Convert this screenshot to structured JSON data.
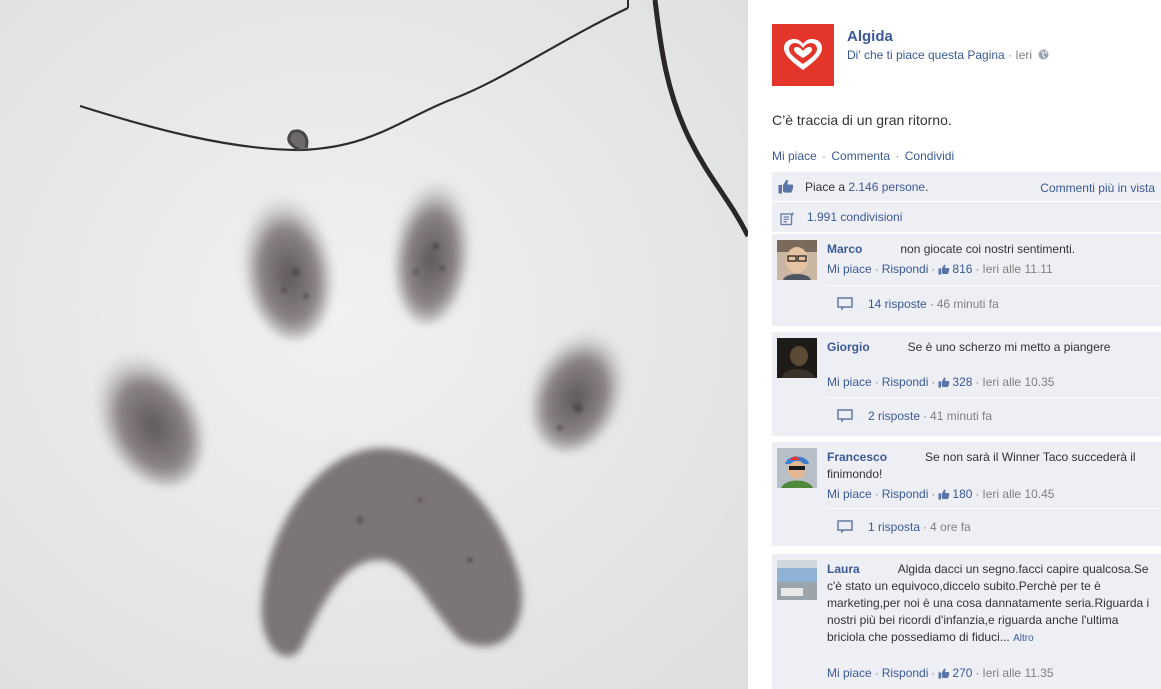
{
  "page": {
    "name": "Algida",
    "like_link": "Di' che ti piace questa Pagina",
    "separator": "·",
    "time": "Ieri"
  },
  "post": {
    "text": "C’è traccia di un gran ritorno."
  },
  "actions": {
    "like": "Mi piace",
    "comment": "Commenta",
    "share": "Condividi"
  },
  "likes": {
    "prefix": "Piace a",
    "count_link": "2.146 persone",
    "suffix": ".",
    "filter": "Commenti più in vista"
  },
  "shares": {
    "text": "1.991 condivisioni"
  },
  "icons": {
    "page_logo": "algida-heart-logo",
    "privacy": "globe-icon",
    "likes": "thumbs-up-icon",
    "shares": "share-icon",
    "replies": "speech-bubble-icon"
  },
  "colors": {
    "link": "#3b5998",
    "brand": "#e3352a",
    "ufi_bg": "#edeff4"
  },
  "comments": [
    {
      "author": "Marco",
      "text": "non giocate coi nostri sentimenti.",
      "like_label": "Mi piace",
      "reply_label": "Rispondi",
      "likes": "816",
      "time": "Ieri alle 11.11",
      "replies": "14 risposte",
      "reply_time": "46 minuti fa"
    },
    {
      "author": "Giorgio",
      "text": "Se è uno scherzo mi metto a piangere",
      "like_label": "Mi piace",
      "reply_label": "Rispondi",
      "likes": "328",
      "time": "Ieri alle 10.35",
      "replies": "2 risposte",
      "reply_time": "41 minuti fa"
    },
    {
      "author": "Francesco",
      "text": "Se non sarà il Winner Taco succederà il finimondo!",
      "like_label": "Mi piace",
      "reply_label": "Rispondi",
      "likes": "180",
      "time": "Ieri alle 10.45",
      "replies": "1 risposta",
      "reply_time": "4 ore fa"
    },
    {
      "author": "Laura",
      "text": "Algida dacci un segno.facci capire qualcosa.Se c'è stato un equivoco,diccelo subito.Perchè per te è marketing,per noi è una cosa dannatamente seria.Riguarda i nostri più bei ricordi d'infanzia,e riguarda anche l'ultima briciola che possediamo di fiduci...",
      "more": "Altro",
      "like_label": "Mi piace",
      "reply_label": "Rispondi",
      "likes": "270",
      "time": "Ieri alle 11.35"
    }
  ]
}
